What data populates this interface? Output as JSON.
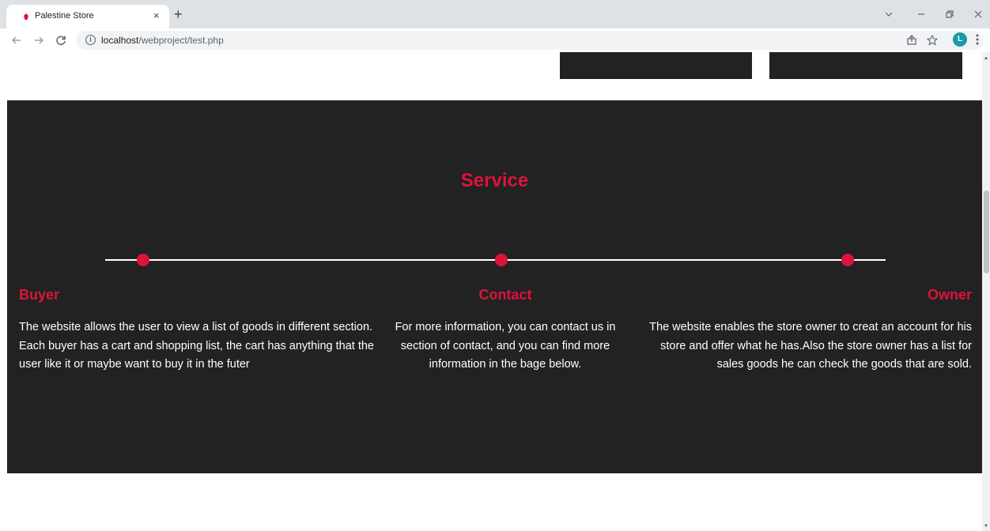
{
  "browser": {
    "tab_title": "Palestine Store",
    "tab_close": "×",
    "new_tab": "+",
    "url_host": "localhost",
    "url_path": "/webproject/test.php",
    "profile_initial": "L",
    "icons": {
      "favicon": "red-palestine-icon",
      "back": "arrow-left-icon",
      "forward": "arrow-right-icon",
      "reload": "reload-icon",
      "site_info": "info-icon",
      "share": "share-icon",
      "bookmark": "star-icon",
      "menu": "kebab-menu-icon"
    }
  },
  "service": {
    "title": "Service",
    "columns": [
      {
        "heading": "Buyer",
        "text": "The website allows the user to view a list of goods in different section. Each buyer has a cart and shopping list, the cart has anything that the user like it or maybe want to buy it in the futer"
      },
      {
        "heading": "Contact",
        "text": "For more information, you can contact us in section of contact, and you can find more information in the bage below."
      },
      {
        "heading": "Owner",
        "text": "The website enables the store owner to creat an account for his store and offer what he has.Also the store owner has a list for sales goods he can check the goods that are sold."
      }
    ]
  },
  "colors": {
    "accent": "#dc143c",
    "section_bg": "#222222",
    "text": "#ffffff"
  }
}
